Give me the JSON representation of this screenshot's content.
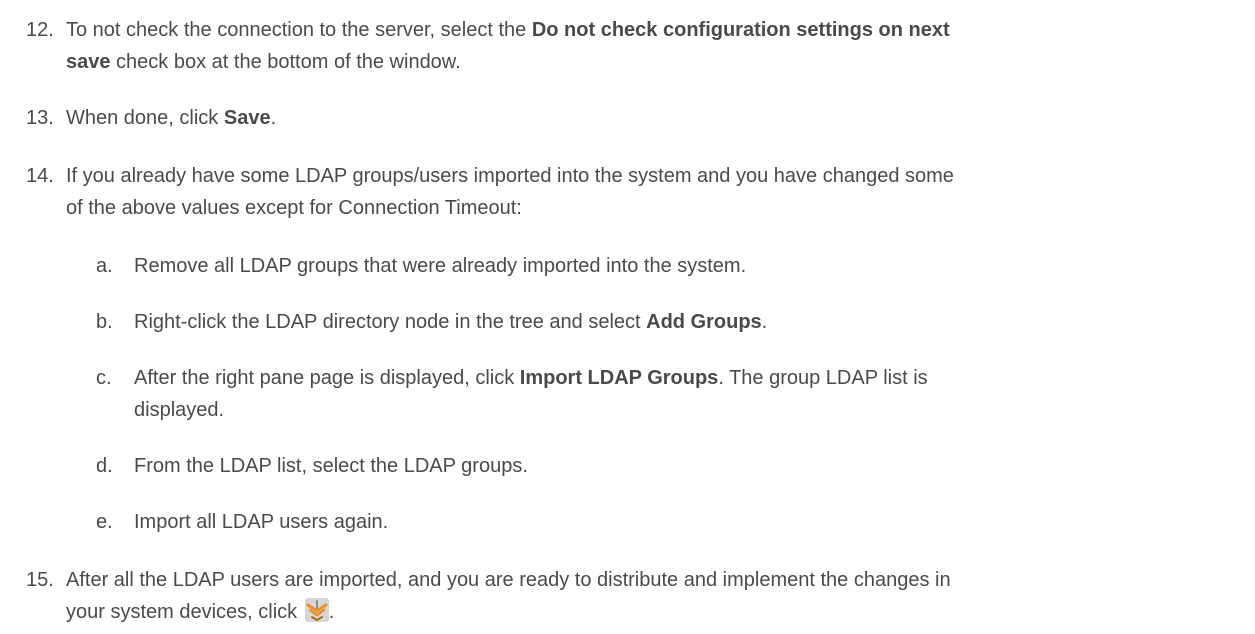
{
  "steps": [
    {
      "number": "12.",
      "line1_pre": "To not check the connection to the server, select the ",
      "line1_bold": "Do not check configuration settings on next",
      "line2_bold": "save",
      "line2_post": " check box at the bottom of the window."
    },
    {
      "number": "13.",
      "pre": "When done, click ",
      "bold": "Save",
      "post": "."
    },
    {
      "number": "14.",
      "line1": "If you already have some LDAP groups/users imported into the system and you have changed some",
      "line2": "of the above values except for Connection Timeout:",
      "substeps": [
        {
          "letter": "a.",
          "text": "Remove all LDAP groups that were already imported into the system."
        },
        {
          "letter": "b.",
          "pre": "Right-click the LDAP directory node in the tree and select ",
          "bold": "Add Groups",
          "post": "."
        },
        {
          "letter": "c.",
          "pre": "After the right pane page is displayed, click ",
          "bold": "Import LDAP Groups",
          "post": ". The group LDAP list is",
          "line2": "displayed."
        },
        {
          "letter": "d.",
          "text": "From the LDAP list, select the LDAP groups."
        },
        {
          "letter": "e.",
          "text": "Import all LDAP users again."
        }
      ]
    },
    {
      "number": "15.",
      "line1": "After all the LDAP users are imported, and you are ready to distribute and implement the changes in",
      "line2_pre": "your system devices, click ",
      "line2_post": ".",
      "icon": "deploy-changes-icon"
    }
  ],
  "colors": {
    "text": "#4a4a4a",
    "icon_orange": "#e8912a",
    "icon_bg": "#c9c9c9"
  }
}
